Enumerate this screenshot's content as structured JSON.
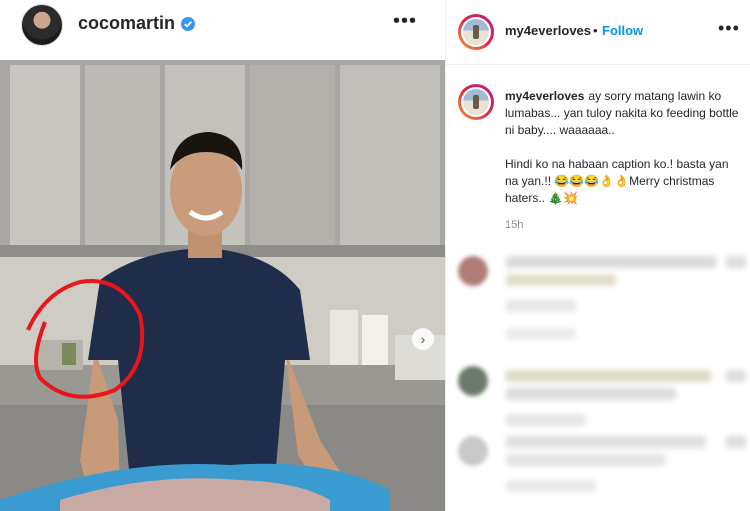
{
  "post": {
    "username": "cocomartin",
    "more_icon": "more-horizontal-icon",
    "verified_icon": "verified-badge-icon",
    "next_icon": "chevron-right-icon",
    "next_glyph": "›"
  },
  "panel": {
    "username": "my4everloves",
    "separator": "•",
    "follow_label": "Follow",
    "more_icon": "more-horizontal-icon",
    "caption_user": "my4everloves",
    "caption_lines": [
      "ay sorry matang lawin ko lumabas... yan tuloy nakita ko feeding bottle ni baby.... waaaaaa..",
      "Hindi ko na habaan caption ko.! basta yan na yan.!! 😂😂😂👌👌Merry christmas haters.. 🎄💥"
    ],
    "time": "15h"
  },
  "colors": {
    "accent": "#0095f6",
    "annotation_circle": "#e8161b",
    "shirt": "#1f2c4a"
  }
}
